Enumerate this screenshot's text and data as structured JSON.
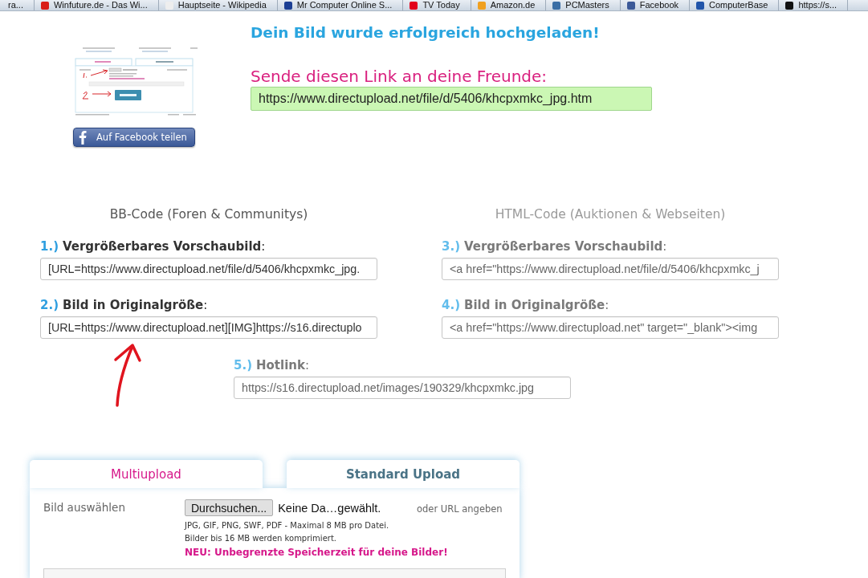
{
  "bookmarks_bar": {
    "items": [
      {
        "label": "ra..."
      },
      {
        "label": "Winfuture.de - Das Wi...",
        "color": "#d91e18"
      },
      {
        "label": "Hauptseite - Wikipedia",
        "color": "#eeeeee"
      },
      {
        "label": "Mr Computer Online S...",
        "color": "#1c3f94"
      },
      {
        "label": "TV Today",
        "color": "#e2001a"
      },
      {
        "label": "Amazon.de",
        "color": "#f0a020"
      },
      {
        "label": "PCMasters",
        "color": "#3a6ea5"
      },
      {
        "label": "Facebook",
        "color": "#3b5998"
      },
      {
        "label": "ComputerBase",
        "color": "#2255aa"
      },
      {
        "label": "https://s...",
        "color": "#111111"
      }
    ]
  },
  "preview": {
    "share_button": "Auf Facebook teilen"
  },
  "result": {
    "title": "Dein Bild wurde erfolgreich hochgeladen!",
    "share_prompt": "Sende diesen Link an deine Freunde:",
    "share_link": "https://www.directupload.net/file/d/5406/khcpxmkc_jpg.htm"
  },
  "code_sections": [
    {
      "heading": "BB-Code (Foren & Communitys)",
      "dimmed": false,
      "fields": [
        {
          "number": "1.)",
          "label": "**Vergrößerbares Vorschaubild**:",
          "value": "[URL=https://www.directupload.net/file/d/5406/khcpxmkc_jpg."
        },
        {
          "number": "2.)",
          "label": "**Bild in Originalgröße**:",
          "value": "[URL=https://www.directupload.net][IMG]https://s16.directuplo"
        }
      ]
    },
    {
      "heading": "HTML-Code (Auktionen & Webseiten)",
      "dimmed": true,
      "fields": [
        {
          "number": "3.)",
          "label": "**Vergrößerbares Vorschaubild**:",
          "value": "<a href=\"https://www.directupload.net/file/d/5406/khcpxmkc_j"
        },
        {
          "number": "4.)",
          "label": "**Bild in Originalgröße**:",
          "value": "<a href=\"https://www.directupload.net\" target=\"_blank\"><img"
        }
      ]
    }
  ],
  "hotlink": {
    "number": "5.)",
    "label": "**Hotlink**:",
    "value": "https://s16.directupload.net/images/190329/khcpxmkc.jpg",
    "dimmed": true
  },
  "upload_panel": {
    "tabs": [
      {
        "label": "Multiupload",
        "selected": false
      },
      {
        "label": "Standard Upload",
        "selected": true
      }
    ],
    "file_label": "Bild auswählen",
    "browse_button": "Durchsuchen...",
    "file_status": "Keine Da…gewählt.",
    "url_link": "oder URL angeben",
    "info_lines": [
      "JPG, GIF, PNG, SWF, PDF - Maximal 8 MB pro Datei.",
      "Bilder bis 16 MB werden komprimiert."
    ],
    "notice": "NEU: Unbegrenzte Speicherzeit für deine Bilder!"
  }
}
